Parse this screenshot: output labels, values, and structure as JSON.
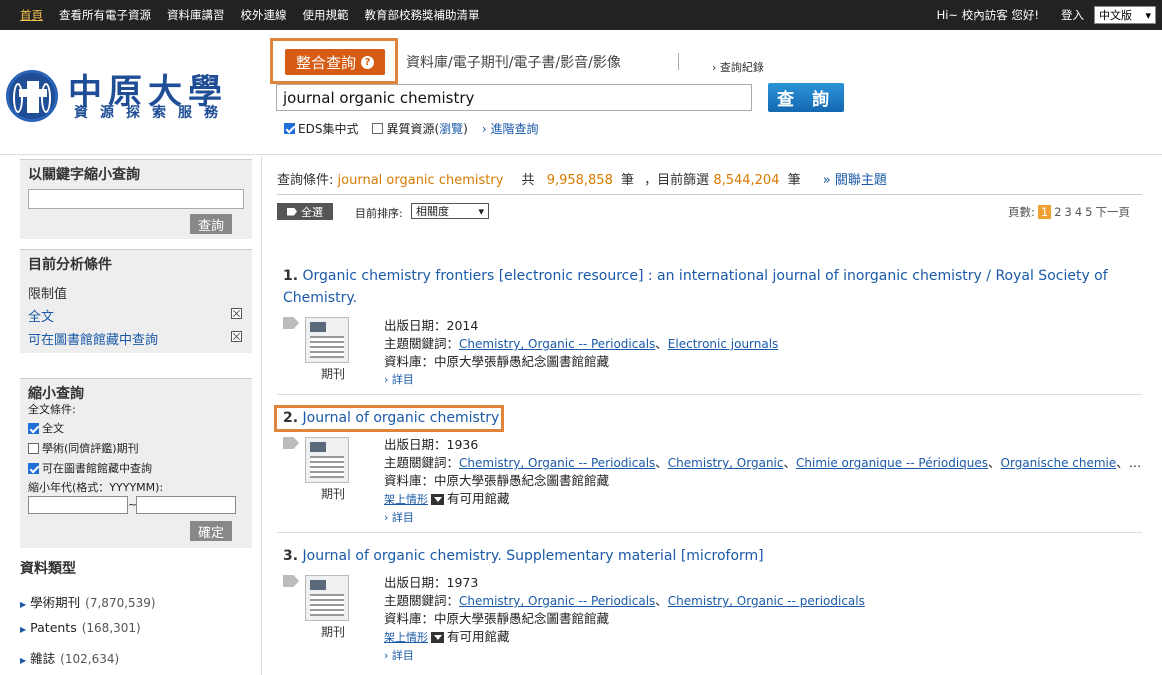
{
  "topnav": {
    "items": [
      "首頁",
      "查看所有電子資源",
      "資料庫講習",
      "校外連線",
      "使用規範",
      "教育部校務獎補助清單"
    ],
    "greeting": "Hi~ 校內訪客 您好!",
    "login": "登入",
    "language": "中文版"
  },
  "logo": {
    "name": "中原大學",
    "subtitle": "資源探索服務"
  },
  "search": {
    "active_type": "整合查詢",
    "other_types": "資料庫/電子期刊/電子書/影音/影像",
    "history": "› 查詢紀錄",
    "query": "journal organic chemistry",
    "button": "查 詢",
    "opt_eds": "EDS集中式",
    "opt_hetero": "異質資源(",
    "opt_browse": "瀏覽",
    "opt_hetero_end": ")",
    "advanced": "› 進階查詢"
  },
  "sidebar": {
    "keyword": {
      "title": "以關鍵字縮小查詢",
      "button": "查詢"
    },
    "current": {
      "title": "目前分析條件",
      "limit_label": "限制值",
      "items": [
        "全文",
        "可在圖書館館藏中查詢"
      ]
    },
    "narrow": {
      "title": "縮小查詢",
      "fulltext_cond": "全文條件:",
      "options": [
        "全文",
        "學術(同儕評鑑)期刊",
        "可在圖書館館藏中查詢"
      ],
      "year_label": "縮小年代(格式：YYYYMM):",
      "year_sep": "~",
      "button": "確定"
    },
    "types": {
      "title": "資料類型",
      "items": [
        {
          "name": "學術期刊",
          "count": "(7,870,539)"
        },
        {
          "name": "Patents",
          "count": "(168,301)"
        },
        {
          "name": "雜誌",
          "count": "(102,634)"
        }
      ]
    }
  },
  "results": {
    "cond_label": "查詢條件:",
    "cond_query": "journal organic chemistry",
    "total_prefix": "共",
    "total": "9,958,858",
    "total_unit": "筆",
    "filter_prefix": "，目前篩選",
    "filtered": "8,544,204",
    "filter_unit": "筆",
    "related": "» 關聯主題",
    "select_all": "全選",
    "sort_label": "目前排序:",
    "sort_value": "相關度",
    "pager": {
      "label": "頁數:",
      "pages": [
        "1",
        "2",
        "3",
        "4",
        "5"
      ],
      "next": "下一頁"
    },
    "records": [
      {
        "num": "1.",
        "title": "Organic chemistry frontiers [electronic resource] : an international journal of inorganic chemistry / Royal Society of",
        "title2": "Chemistry.",
        "type": "期刊",
        "date": "出版日期：2014",
        "subj_label": "主題關鍵詞：",
        "subjects": [
          "Chemistry, Organic -- Periodicals",
          "Electronic journals"
        ],
        "db": "資料庫：中原大學張靜愚紀念圖書館館藏",
        "detail": "› 詳目"
      },
      {
        "num": "2.",
        "title": "Journal of organic chemistry",
        "type": "期刊",
        "date": "出版日期：1936",
        "subj_label": "主題關鍵詞：",
        "subjects": [
          "Chemistry, Organic -- Periodicals",
          "Chemistry, Organic",
          "Chimie organique -- Périodiques",
          "Organische chemie"
        ],
        "subj_more": "、…",
        "db": "資料庫：中原大學張靜愚紀念圖書館館藏",
        "shelf": "架上情形",
        "holdings": "有可用館藏",
        "detail": "› 詳目"
      },
      {
        "num": "3.",
        "title": "Journal of organic chemistry. Supplementary material [microform]",
        "type": "期刊",
        "date": "出版日期：1973",
        "subj_label": "主題關鍵詞：",
        "subjects": [
          "Chemistry, Organic -- Periodicals",
          "Chemistry, Organic -- periodicals"
        ],
        "db": "資料庫：中原大學張靜愚紀念圖書館館藏",
        "shelf": "架上情形",
        "holdings": "有可用館藏",
        "detail": "› 詳目"
      }
    ]
  },
  "colors": {
    "accent": "#d75b12",
    "link": "#1a5aa8",
    "highlight_box": "#e0843a",
    "topbar": "#222222"
  }
}
